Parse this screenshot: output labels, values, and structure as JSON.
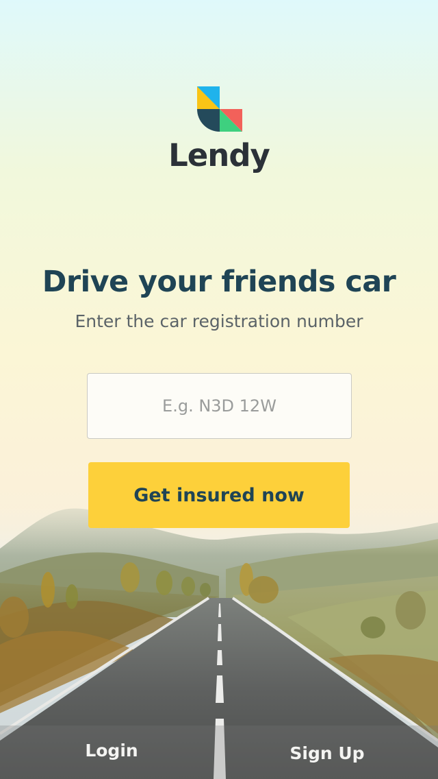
{
  "brand": {
    "name": "Lendy",
    "logo_colors": {
      "blue": "#1fb3ec",
      "yellow": "#f9c416",
      "navy": "#244a5b",
      "green": "#3ed07f",
      "coral": "#f2615a"
    }
  },
  "hero": {
    "headline": "Drive your friends car",
    "subheadline": "Enter the car registration number"
  },
  "form": {
    "registration_placeholder": "E.g. N3D 12W",
    "registration_value": "",
    "submit_label": "Get insured now"
  },
  "nav": {
    "login_label": "Login",
    "signup_label": "Sign Up"
  },
  "colors": {
    "accent": "#fdd03a",
    "heading": "#1f4455",
    "subtext": "#5b6368"
  },
  "background": {
    "scene": "country-road-photo"
  }
}
